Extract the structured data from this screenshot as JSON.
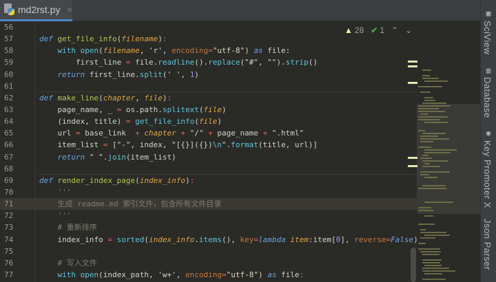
{
  "tab": {
    "filename": "md2rst.py",
    "close": "×"
  },
  "inspections": {
    "warnings": "28",
    "typos": "1"
  },
  "sidebar": [
    "SciView",
    "Database",
    "Key Promoter X",
    "Json Parser"
  ],
  "lines": [
    {
      "n": "56",
      "t": []
    },
    {
      "n": "57",
      "t": [
        [
          "def",
          "kw"
        ],
        [
          " "
        ],
        [
          "get_file_info",
          "fn"
        ],
        [
          "("
        ],
        [
          "filename",
          "pa"
        ],
        [
          ")"
        ],
        [
          ":",
          "op"
        ]
      ]
    },
    {
      "n": "58",
      "t": [
        [
          "    "
        ],
        [
          "with",
          "kw2"
        ],
        [
          " "
        ],
        [
          "open",
          "ca"
        ],
        [
          "("
        ],
        [
          "filename",
          "pa"
        ],
        [
          ", 'r', "
        ],
        [
          "encoding",
          "kwa"
        ],
        [
          "=",
          "op"
        ],
        [
          "\"utf-8\"",
          "st"
        ],
        [
          ") "
        ],
        [
          "as",
          "kw"
        ],
        [
          " file:"
        ]
      ]
    },
    {
      "n": "59",
      "t": [
        [
          "        first_line "
        ],
        [
          "=",
          "op"
        ],
        [
          " file."
        ],
        [
          "readline",
          "ca"
        ],
        [
          "()."
        ],
        [
          "replace",
          "ca"
        ],
        [
          "(\"#\", \"\")."
        ],
        [
          "strip",
          "ca"
        ],
        [
          "()"
        ]
      ]
    },
    {
      "n": "60",
      "t": [
        [
          "    "
        ],
        [
          "return",
          "kw"
        ],
        [
          " first_line."
        ],
        [
          "split",
          "ca"
        ],
        [
          "(' ', "
        ],
        [
          "1",
          "nu"
        ],
        [
          ")"
        ]
      ]
    },
    {
      "n": "61",
      "t": []
    },
    {
      "n": "62",
      "sep": true,
      "t": [
        [
          "def",
          "kw"
        ],
        [
          " "
        ],
        [
          "make_line",
          "fn"
        ],
        [
          "("
        ],
        [
          "chapter",
          "pa"
        ],
        [
          ", "
        ],
        [
          "file",
          "pa"
        ],
        [
          ")"
        ],
        [
          ":",
          "op"
        ]
      ]
    },
    {
      "n": "63",
      "t": [
        [
          "    page_name, _ "
        ],
        [
          "=",
          "op"
        ],
        [
          " os.path."
        ],
        [
          "splitext",
          "ca"
        ],
        [
          "("
        ],
        [
          "file",
          "pa"
        ],
        [
          ")"
        ]
      ]
    },
    {
      "n": "64",
      "t": [
        [
          "    (index, title) "
        ],
        [
          "=",
          "op"
        ],
        [
          " "
        ],
        [
          "get_file_info",
          "ca"
        ],
        [
          "("
        ],
        [
          "file",
          "pa"
        ],
        [
          ")"
        ]
      ]
    },
    {
      "n": "65",
      "t": [
        [
          "    url "
        ],
        [
          "=",
          "op"
        ],
        [
          " base_link  "
        ],
        [
          "+",
          "op"
        ],
        [
          " "
        ],
        [
          "chapter",
          "pa"
        ],
        [
          " "
        ],
        [
          "+",
          "op"
        ],
        [
          " \"/\" "
        ],
        [
          "+",
          "op"
        ],
        [
          " page_name "
        ],
        [
          "+",
          "op"
        ],
        [
          " \".html\""
        ]
      ]
    },
    {
      "n": "66",
      "t": [
        [
          "    item_list "
        ],
        [
          "=",
          "op"
        ],
        [
          " [\"-\", index, \"[{}]({})"
        ],
        [
          "\\n",
          "es"
        ],
        [
          "\"."
        ],
        [
          "format",
          "ca"
        ],
        [
          "(title, url)]"
        ]
      ]
    },
    {
      "n": "67",
      "t": [
        [
          "    "
        ],
        [
          "return",
          "kw"
        ],
        [
          " \" \"."
        ],
        [
          "join",
          "ca"
        ],
        [
          "(item_list)"
        ]
      ]
    },
    {
      "n": "68",
      "t": []
    },
    {
      "n": "69",
      "sep": true,
      "t": [
        [
          "def",
          "kw"
        ],
        [
          " "
        ],
        [
          "render_index_page",
          "fn"
        ],
        [
          "("
        ],
        [
          "index_info",
          "pa"
        ],
        [
          ")"
        ],
        [
          ":",
          "op"
        ]
      ]
    },
    {
      "n": "70",
      "t": [
        [
          "    '''",
          "cm"
        ]
      ]
    },
    {
      "n": "71",
      "hl": true,
      "t": [
        [
          "    生成 readme.md 索引文件，包含所有文件目录",
          "cm"
        ]
      ]
    },
    {
      "n": "72",
      "t": [
        [
          "    '''",
          "cm"
        ]
      ]
    },
    {
      "n": "73",
      "t": [
        [
          "    # 重新排序",
          "cm"
        ]
      ]
    },
    {
      "n": "74",
      "t": [
        [
          "    index_info "
        ],
        [
          "=",
          "op"
        ],
        [
          " "
        ],
        [
          "sorted",
          "ca"
        ],
        [
          "("
        ],
        [
          "index_info",
          "pa"
        ],
        [
          "."
        ],
        [
          "items",
          "ca"
        ],
        [
          "(), "
        ],
        [
          "key",
          "kwa"
        ],
        [
          "=",
          "op"
        ],
        [
          "lambda",
          "kw"
        ],
        [
          " "
        ],
        [
          "item",
          "pa"
        ],
        [
          ":item["
        ],
        [
          "0",
          "nu"
        ],
        [
          "], "
        ],
        [
          "reverse",
          "kwa"
        ],
        [
          "=",
          "op"
        ],
        [
          "False",
          "kw"
        ],
        [
          ")"
        ]
      ]
    },
    {
      "n": "75",
      "t": []
    },
    {
      "n": "76",
      "t": [
        [
          "    # 写入文件",
          "cm"
        ]
      ]
    },
    {
      "n": "77",
      "t": [
        [
          "    "
        ],
        [
          "with",
          "kw2"
        ],
        [
          " "
        ],
        [
          "open",
          "ca"
        ],
        [
          "(index_path, 'w+', "
        ],
        [
          "encoding",
          "kwa"
        ],
        [
          "=",
          "op"
        ],
        [
          "\"utf-8\"",
          "st"
        ],
        [
          ") "
        ],
        [
          "as",
          "kw"
        ],
        [
          " file"
        ],
        [
          ":",
          "op"
        ]
      ]
    }
  ]
}
